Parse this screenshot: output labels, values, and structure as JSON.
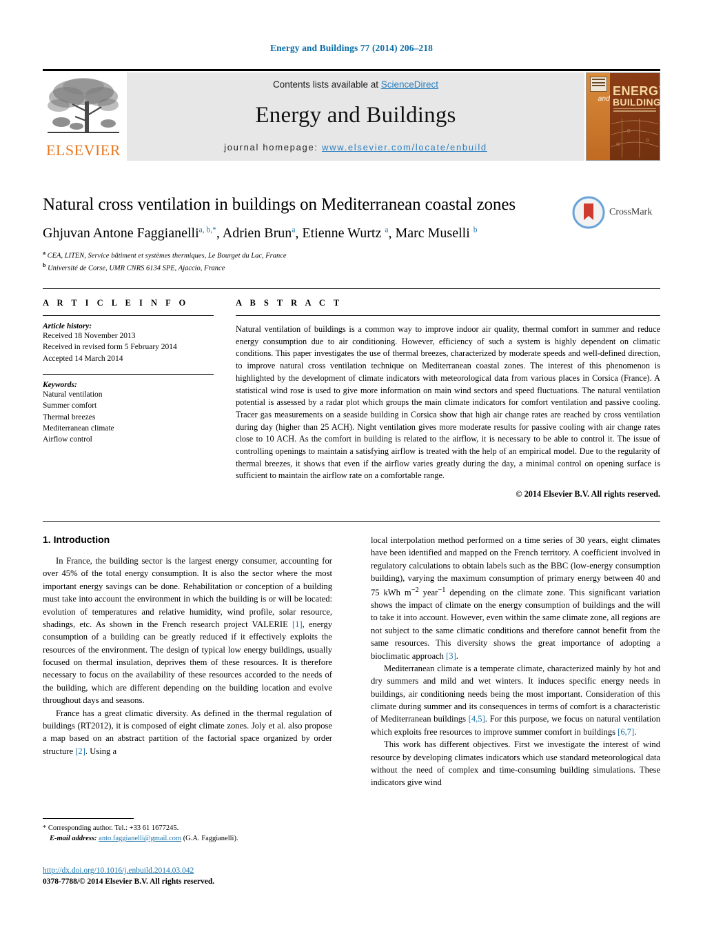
{
  "running_head": "Energy and Buildings 77 (2014) 206–218",
  "masthead": {
    "contents_prefix": "Contents lists available at ",
    "sciencedirect": "ScienceDirect",
    "journal_name": "Energy and Buildings",
    "homepage_prefix": "journal homepage: ",
    "homepage_url": "www.elsevier.com/locate/enbuild",
    "publisher": "ELSEVIER",
    "cover": {
      "and": "and",
      "energy": "ENERGY",
      "buildings": "BUILDINGS"
    },
    "link_color": "#2a7fc1"
  },
  "article": {
    "title": "Natural cross ventilation in buildings on Mediterranean coastal zones",
    "authors_html": "Ghjuvan Antone Faggianelli<sup>a, b,</sup><sup class=\"star\">*</sup>, Adrien Brun<sup>a</sup>, Etienne Wurtz <sup>a</sup>, Marc Muselli <sup>b</sup>",
    "affiliations": [
      {
        "marker": "a",
        "text": "CEA, LITEN, Service bâtiment et systèmes thermiques, Le Bourget du Lac, France"
      },
      {
        "marker": "b",
        "text": "Université de Corse, UMR CNRS 6134 SPE, Ajaccio, France"
      }
    ],
    "crossmark_label": "CrossMark"
  },
  "info": {
    "heading": "A R T I C L E   I N F O",
    "history_title": "Article history:",
    "history": [
      "Received 18 November 2013",
      "Received in revised form 5 February 2014",
      "Accepted 14 March 2014"
    ],
    "keywords_title": "Keywords:",
    "keywords": [
      "Natural ventilation",
      "Summer comfort",
      "Thermal breezes",
      "Mediterranean climate",
      "Airflow control"
    ]
  },
  "abstract": {
    "heading": "A B S T R A C T",
    "text": "Natural ventilation of buildings is a common way to improve indoor air quality, thermal comfort in summer and reduce energy consumption due to air conditioning. However, efficiency of such a system is highly dependent on climatic conditions. This paper investigates the use of thermal breezes, characterized by moderate speeds and well-defined direction, to improve natural cross ventilation technique on Mediterranean coastal zones. The interest of this phenomenon is highlighted by the development of climate indicators with meteorological data from various places in Corsica (France). A statistical wind rose is used to give more information on main wind sectors and speed fluctuations. The natural ventilation potential is assessed by a radar plot which groups the main climate indicators for comfort ventilation and passive cooling. Tracer gas measurements on a seaside building in Corsica show that high air change rates are reached by cross ventilation during day (higher than 25 ACH). Night ventilation gives more moderate results for passive cooling with air change rates close to 10 ACH. As the comfort in building is related to the airflow, it is necessary to be able to control it. The issue of controlling openings to maintain a satisfying airflow is treated with the help of an empirical model. Due to the regularity of thermal breezes, it shows that even if the airflow varies greatly during the day, a minimal control on opening surface is sufficient to maintain the airflow rate on a comfortable range.",
    "copyright": "© 2014 Elsevier B.V. All rights reserved."
  },
  "introduction": {
    "section_title": "1.  Introduction",
    "left_paragraphs": [
      "In France, the building sector is the largest energy consumer, accounting for over 45% of the total energy consumption. It is also the sector where the most important energy savings can be done. Rehabilitation or conception of a building must take into account the environment in which the building is or will be located: evolution of temperatures and relative humidity, wind profile, solar resource, shadings, etc. As shown in the French research project VALERIE <span class=\"ref\">[1]</span>, energy consumption of a building can be greatly reduced if it effectively exploits the resources of the environment. The design of typical low energy buildings, usually focused on thermal insulation, deprives them of these resources. It is therefore necessary to focus on the availability of these resources accorded to the needs of the building, which are different depending on the building location and evolve throughout days and seasons.",
      "France has a great climatic diversity. As defined in the thermal regulation of buildings (RT2012), it is composed of eight climate zones. Joly et al. also propose a map based on an abstract partition of the factorial space organized by order structure <span class=\"ref\">[2]</span>. Using a"
    ],
    "right_paragraphs": [
      "local interpolation method performed on a time series of 30 years, eight climates have been identified and mapped on the French territory. A coefficient involved in regulatory calculations to obtain labels such as the BBC (low-energy consumption building), varying the maximum consumption of primary energy between 40 and 75 kWh m<sup>−2</sup> year<sup>−1</sup> depending on the climate zone. This significant variation shows the impact of climate on the energy consumption of buildings and the will to take it into account. However, even within the same climate zone, all regions are not subject to the same climatic conditions and therefore cannot benefit from the same resources. This diversity shows the great importance of adopting a bioclimatic approach <span class=\"ref\">[3]</span>.",
      "Mediterranean climate is a temperate climate, characterized mainly by hot and dry summers and mild and wet winters. It induces specific energy needs in buildings, air conditioning needs being the most important. Consideration of this climate during summer and its consequences in terms of comfort is a characteristic of Mediterranean buildings <span class=\"ref\">[4,5]</span>. For this purpose, we focus on natural ventilation which exploits free resources to improve summer comfort in buildings <span class=\"ref\">[6,7]</span>.",
      "This work has different objectives. First we investigate the interest of wind resource by developing climates indicators which use standard meteorological data without the need of complex and time-consuming building simulations. These indicators give wind"
    ]
  },
  "footnote": {
    "corresponding": "*  Corresponding author. Tel.: +33 61 1677245.",
    "email_label": "E-mail address:",
    "email": "anto.faggianelli@gmail.com",
    "email_suffix": " (G.A. Faggianelli)."
  },
  "footer": {
    "doi": "http://dx.doi.org/10.1016/j.enbuild.2014.03.042",
    "issn": "0378-7788/© 2014 Elsevier B.V. All rights reserved."
  }
}
